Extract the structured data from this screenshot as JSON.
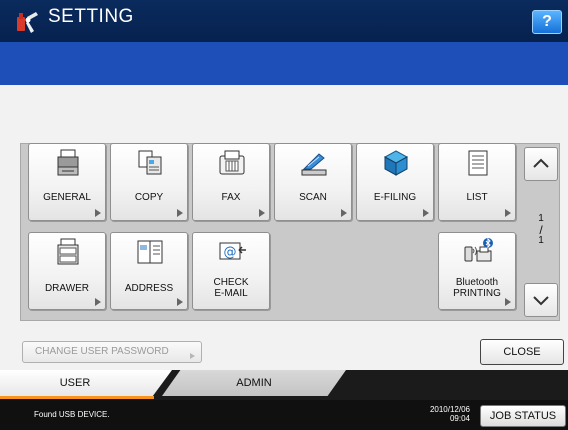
{
  "header": {
    "title": "SETTING",
    "help_label": "?"
  },
  "tiles": {
    "general": {
      "label": "GENERAL",
      "icon": "general-icon"
    },
    "copy": {
      "label": "COPY",
      "icon": "copy-icon"
    },
    "fax": {
      "label": "FAX",
      "icon": "fax-icon"
    },
    "scan": {
      "label": "SCAN",
      "icon": "scan-icon"
    },
    "efiling": {
      "label": "E-FILING",
      "icon": "efiling-icon"
    },
    "list": {
      "label": "LIST",
      "icon": "list-icon"
    },
    "drawer": {
      "label": "DRAWER",
      "icon": "drawer-icon"
    },
    "address": {
      "label": "ADDRESS",
      "icon": "address-icon"
    },
    "checkmail": {
      "line1": "CHECK",
      "line2": "E-MAIL",
      "icon": "email-icon"
    },
    "bluetooth": {
      "line1": "Bluetooth",
      "line2": "PRINTING",
      "icon": "bluetooth-icon"
    }
  },
  "pager": {
    "current": "1",
    "separator": "/",
    "total": "1"
  },
  "buttons": {
    "change_password": "CHANGE USER PASSWORD",
    "close": "CLOSE",
    "job_status": "JOB STATUS"
  },
  "tabs": {
    "user": "USER",
    "admin": "ADMIN"
  },
  "status": {
    "message": "Found USB DEVICE.",
    "date": "2010/12/06",
    "time": "09:04"
  },
  "colors": {
    "title_bar": "#0a2b5e",
    "blue_band": "#1e4fb8",
    "help_button": "#1f86ec",
    "tab_accent": "#f7931e"
  }
}
